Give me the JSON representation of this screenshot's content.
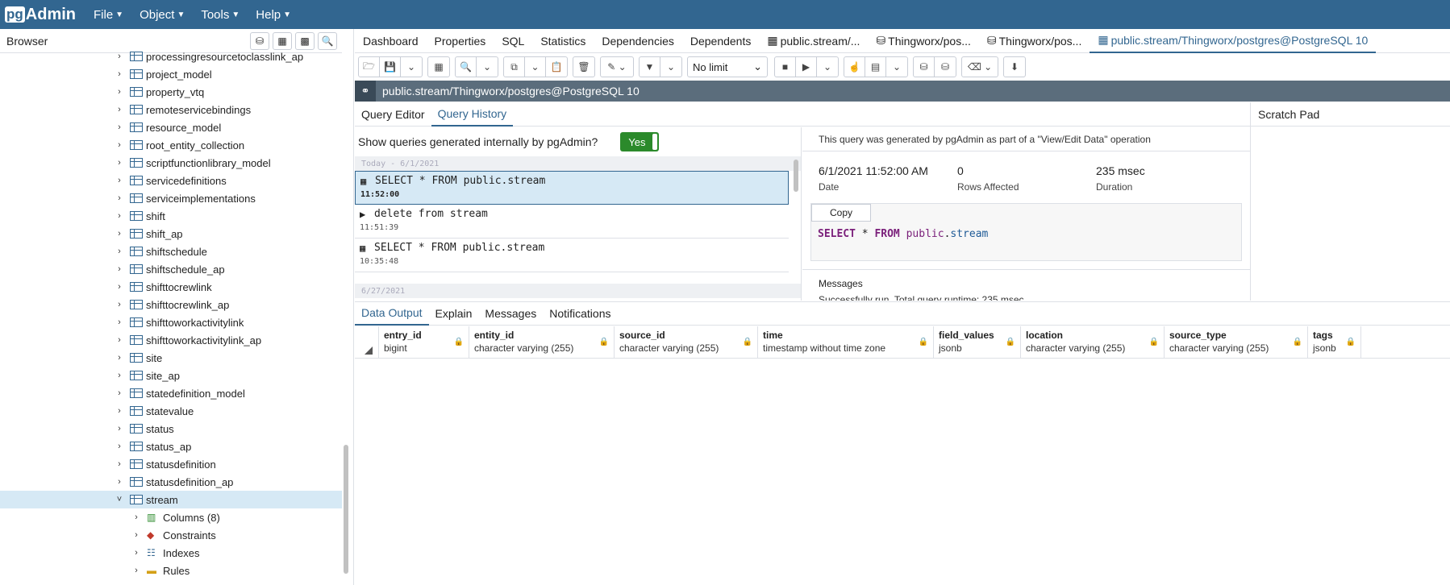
{
  "app": {
    "logo_pg": "pg",
    "logo_admin": "Admin"
  },
  "menu": [
    {
      "label": "File"
    },
    {
      "label": "Object"
    },
    {
      "label": "Tools"
    },
    {
      "label": "Help"
    }
  ],
  "browser": {
    "title": "Browser",
    "tree": [
      {
        "label": "processingresourcetoclasslink_ap",
        "expanded": false
      },
      {
        "label": "project_model",
        "expanded": false
      },
      {
        "label": "property_vtq",
        "expanded": false
      },
      {
        "label": "remoteservicebindings",
        "expanded": false
      },
      {
        "label": "resource_model",
        "expanded": false
      },
      {
        "label": "root_entity_collection",
        "expanded": false
      },
      {
        "label": "scriptfunctionlibrary_model",
        "expanded": false
      },
      {
        "label": "servicedefinitions",
        "expanded": false
      },
      {
        "label": "serviceimplementations",
        "expanded": false
      },
      {
        "label": "shift",
        "expanded": false
      },
      {
        "label": "shift_ap",
        "expanded": false
      },
      {
        "label": "shiftschedule",
        "expanded": false
      },
      {
        "label": "shiftschedule_ap",
        "expanded": false
      },
      {
        "label": "shifttocrewlink",
        "expanded": false
      },
      {
        "label": "shifttocrewlink_ap",
        "expanded": false
      },
      {
        "label": "shifttoworkactivitylink",
        "expanded": false
      },
      {
        "label": "shifttoworkactivitylink_ap",
        "expanded": false
      },
      {
        "label": "site",
        "expanded": false
      },
      {
        "label": "site_ap",
        "expanded": false
      },
      {
        "label": "statedefinition_model",
        "expanded": false
      },
      {
        "label": "statevalue",
        "expanded": false
      },
      {
        "label": "status",
        "expanded": false
      },
      {
        "label": "status_ap",
        "expanded": false
      },
      {
        "label": "statusdefinition",
        "expanded": false
      },
      {
        "label": "statusdefinition_ap",
        "expanded": false
      },
      {
        "label": "stream",
        "expanded": true,
        "selected": true
      }
    ],
    "children": [
      {
        "label": "Columns (8)",
        "icon": "columns-icon"
      },
      {
        "label": "Constraints",
        "icon": "constraints-icon"
      },
      {
        "label": "Indexes",
        "icon": "indexes-icon"
      },
      {
        "label": "Rules",
        "icon": "rules-icon"
      }
    ]
  },
  "tabs": [
    {
      "label": "Dashboard"
    },
    {
      "label": "Properties"
    },
    {
      "label": "SQL"
    },
    {
      "label": "Statistics"
    },
    {
      "label": "Dependencies"
    },
    {
      "label": "Dependents"
    },
    {
      "label": "public.stream/...",
      "icon": "table-icon"
    },
    {
      "label": "Thingworx/pos...",
      "icon": "database-icon"
    },
    {
      "label": "Thingworx/pos...",
      "icon": "database-icon"
    },
    {
      "label": "public.stream/Thingworx/postgres@PostgreSQL 10",
      "icon": "table-icon",
      "active": true
    }
  ],
  "toolbar": {
    "limit": "No limit"
  },
  "connection": {
    "label": "public.stream/Thingworx/postgres@PostgreSQL 10"
  },
  "query_tabs": [
    {
      "label": "Query Editor"
    },
    {
      "label": "Query History",
      "active": true
    }
  ],
  "scratch_pad": {
    "title": "Scratch Pad"
  },
  "history": {
    "toggle_label": "Show queries generated internally by pgAdmin?",
    "toggle_value": "Yes",
    "groups": [
      {
        "date": "Today - 6/1/2021",
        "entries": [
          {
            "query": "SELECT * FROM public.stream",
            "time": "11:52:00",
            "icon": "grid-icon",
            "selected": true
          },
          {
            "query": "delete from stream",
            "time": "11:51:39",
            "icon": "play-icon"
          },
          {
            "query": "SELECT * FROM public.stream",
            "time": "10:35:48",
            "icon": "grid-icon"
          }
        ]
      },
      {
        "date": "6/27/2021",
        "entries": []
      }
    ],
    "detail": {
      "note": "This query was generated by pgAdmin as part of a \"View/Edit Data\" operation",
      "date_value": "6/1/2021 11:52:00 AM",
      "date_label": "Date",
      "rows_value": "0",
      "rows_label": "Rows Affected",
      "duration_value": "235 msec",
      "duration_label": "Duration",
      "copy_label": "Copy",
      "sql_keyword1": "SELECT",
      "sql_star": " * ",
      "sql_keyword2": "FROM",
      "sql_schema": " public",
      "sql_dot": ".",
      "sql_table": "stream",
      "messages_title": "Messages",
      "messages_text": "Successfully run. Total query runtime: 235 msec."
    }
  },
  "data_tabs": [
    {
      "label": "Data Output",
      "active": true
    },
    {
      "label": "Explain"
    },
    {
      "label": "Messages"
    },
    {
      "label": "Notifications"
    }
  ],
  "columns": [
    {
      "name": "entry_id",
      "type": "bigint"
    },
    {
      "name": "entity_id",
      "type": "character varying (255)"
    },
    {
      "name": "source_id",
      "type": "character varying (255)"
    },
    {
      "name": "time",
      "type": "timestamp without time zone"
    },
    {
      "name": "field_values",
      "type": "jsonb"
    },
    {
      "name": "location",
      "type": "character varying (255)"
    },
    {
      "name": "source_type",
      "type": "character varying (255)"
    },
    {
      "name": "tags",
      "type": "jsonb"
    }
  ]
}
